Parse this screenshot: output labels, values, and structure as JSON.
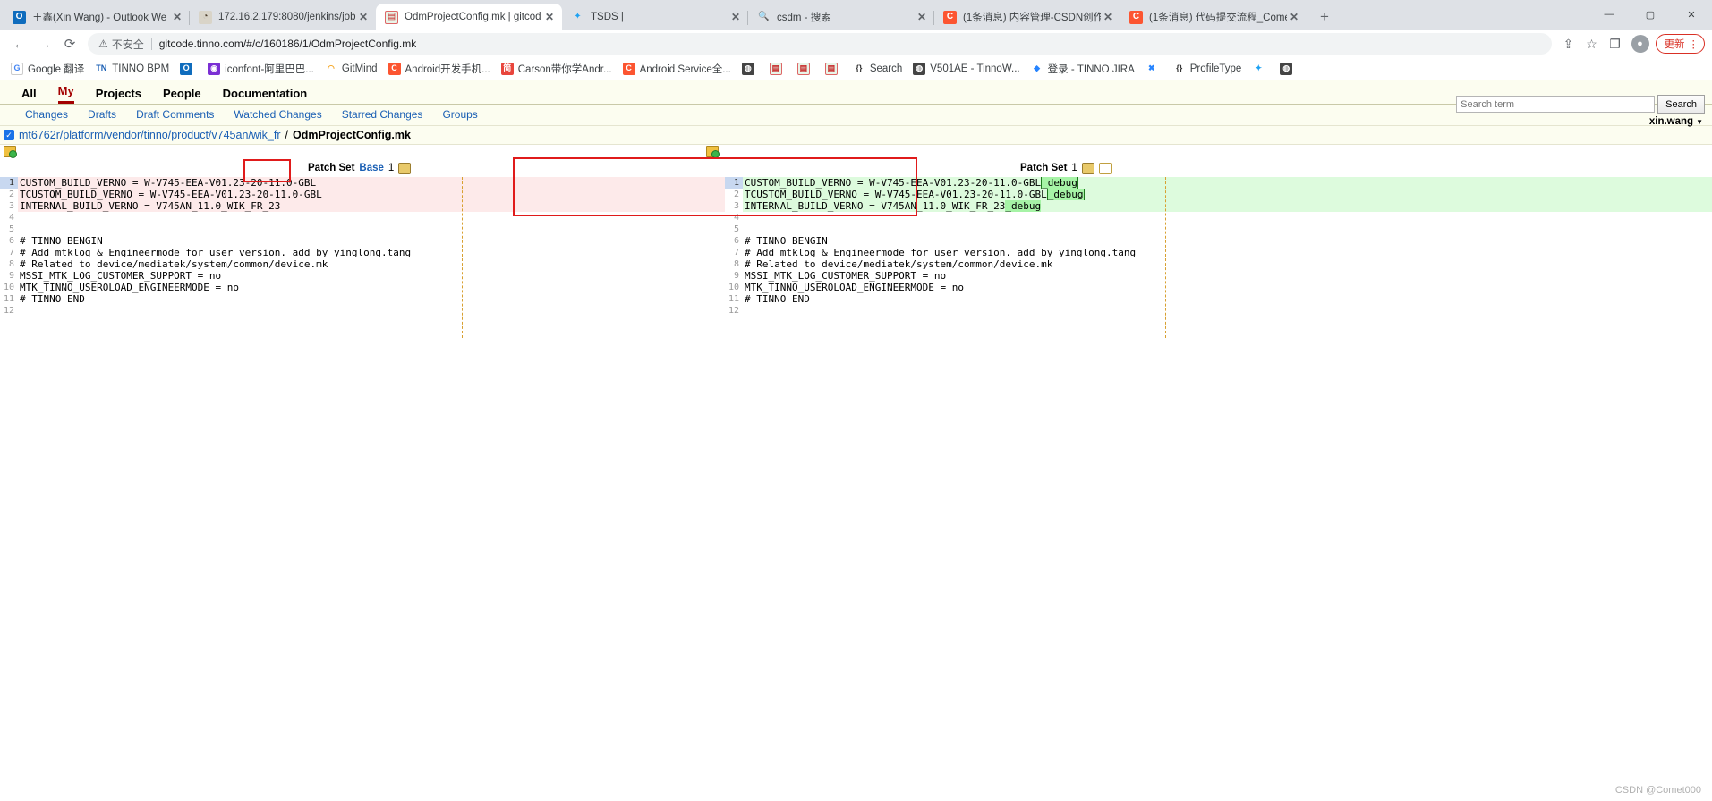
{
  "browser": {
    "tabs": [
      {
        "title": "王鑫(Xin Wang) - Outlook We",
        "favicon": "outlook-icon",
        "active": false
      },
      {
        "title": "172.16.2.179:8080/jenkins/job",
        "favicon": "jenkins-icon",
        "active": false
      },
      {
        "title": "OdmProjectConfig.mk | gitcod",
        "favicon": "gerrit-icon",
        "active": true
      },
      {
        "title": "TSDS |",
        "favicon": "twitter-icon",
        "active": false
      },
      {
        "title": "csdm - 搜索",
        "favicon": "search-icon",
        "active": false
      },
      {
        "title": "(1条消息) 内容管理-CSDN创作",
        "favicon": "csdn-icon",
        "active": false
      },
      {
        "title": "(1条消息) 代码提交流程_Comet",
        "favicon": "csdn-icon",
        "active": false
      }
    ],
    "new_tab_label": "+",
    "window_controls": {
      "minimize": "—",
      "maximize": "▢",
      "close": "✕"
    },
    "nav": {
      "back": "←",
      "forward": "→",
      "reload": "⟳"
    },
    "omnibox": {
      "security_label": "不安全",
      "security_icon": "warning-triangle-icon",
      "url": "gitcode.tinno.com/#/c/160186/1/OdmProjectConfig.mk"
    },
    "toolbar_icons": {
      "share": "share-icon",
      "bookmark": "star-icon",
      "sidepanel": "side-panel-icon",
      "profile": "avatar-icon",
      "update_label": "更新",
      "menu": "kebab-menu-icon"
    },
    "bookmarks": [
      {
        "label": "Google 翻译",
        "icon": "google-translate-icon",
        "icon_class": "bmi-g",
        "glyph": "G"
      },
      {
        "label": "TINNO BPM",
        "icon": "tinno-bpm-icon",
        "icon_class": "bmi-tn",
        "glyph": "TN"
      },
      {
        "label": "",
        "icon": "outlook-icon",
        "icon_class": "bmi-ol",
        "glyph": "O"
      },
      {
        "label": "iconfont-阿里巴巴...",
        "icon": "iconfont-icon",
        "icon_class": "bmi-if",
        "glyph": "◉"
      },
      {
        "label": "GitMind",
        "icon": "gitmind-icon",
        "icon_class": "bmi-gm",
        "glyph": "◠"
      },
      {
        "label": "Android开发手机...",
        "icon": "csdn-icon",
        "icon_class": "bmi-c",
        "glyph": "C"
      },
      {
        "label": "Carson带你学Andr...",
        "icon": "jianshu-icon",
        "icon_class": "bmi-j",
        "glyph": "简"
      },
      {
        "label": "Android Service全...",
        "icon": "csdn-icon",
        "icon_class": "bmi-c",
        "glyph": "C"
      },
      {
        "label": "",
        "icon": "globe-icon",
        "icon_class": "bmi-w",
        "glyph": "◍"
      },
      {
        "label": "",
        "icon": "gerrit-icon",
        "icon_class": "bmi-gr",
        "glyph": "▤"
      },
      {
        "label": "",
        "icon": "gerrit-icon",
        "icon_class": "bmi-gr",
        "glyph": "▤"
      },
      {
        "label": "",
        "icon": "gerrit-icon",
        "icon_class": "bmi-gr",
        "glyph": "▤"
      },
      {
        "label": "Search",
        "icon": "braces-icon",
        "icon_class": "bmi-br",
        "glyph": "{}"
      },
      {
        "label": "V501AE - TinnoW...",
        "icon": "globe-icon",
        "icon_class": "bmi-w",
        "glyph": "◍"
      },
      {
        "label": "登录 - TINNO JIRA",
        "icon": "jira-icon",
        "icon_class": "bmi-ji",
        "glyph": "◆"
      },
      {
        "label": "",
        "icon": "jira-icon",
        "icon_class": "bmi-ji",
        "glyph": "✖"
      },
      {
        "label": "ProfileType",
        "icon": "braces-icon",
        "icon_class": "bmi-br",
        "glyph": "{}"
      },
      {
        "label": "",
        "icon": "twitter-icon",
        "icon_class": "bmi-x",
        "glyph": "✦"
      },
      {
        "label": "",
        "icon": "globe-icon",
        "icon_class": "bmi-w",
        "glyph": "◍"
      }
    ]
  },
  "gerrit": {
    "main_menu": [
      {
        "label": "All",
        "active": false
      },
      {
        "label": "My",
        "active": true
      },
      {
        "label": "Projects",
        "active": false
      },
      {
        "label": "People",
        "active": false
      },
      {
        "label": "Documentation",
        "active": false
      }
    ],
    "sub_menu": [
      "Changes",
      "Drafts",
      "Draft Comments",
      "Watched Changes",
      "Starred Changes",
      "Groups"
    ],
    "search": {
      "placeholder": "Search term",
      "value": "",
      "button_label": "Search"
    },
    "user": "xin.wang",
    "file": {
      "path": "mt6762r/platform/vendor/tinno/product/v745an/wik_fr",
      "separator": "/",
      "name": "OdmProjectConfig.mk"
    },
    "patchset_left": {
      "label": "Patch Set",
      "base": "Base",
      "number": "1"
    },
    "patchset_right": {
      "label": "Patch Set",
      "number": "1"
    }
  },
  "diff": {
    "left": [
      {
        "n": "1",
        "text": "CUSTOM_BUILD_VERNO = W-V745-EEA-V01.23-20-11.0-GBL",
        "type": "del",
        "current": true
      },
      {
        "n": "2",
        "text": "TCUSTOM_BUILD_VERNO = W-V745-EEA-V01.23-20-11.0-GBL",
        "type": "del"
      },
      {
        "n": "3",
        "text": "INTERNAL_BUILD_VERNO = V745AN_11.0_WIK_FR_23",
        "type": "del"
      },
      {
        "n": "4",
        "text": "",
        "type": "del"
      },
      {
        "n": "5",
        "text": "",
        "type": "ctx"
      },
      {
        "n": "6",
        "text": "# TINNO BENGIN",
        "type": "ctx"
      },
      {
        "n": "7",
        "text": "# Add mtklog & Engineermode for user version. add by yinglong.tang",
        "type": "ctx"
      },
      {
        "n": "8",
        "text": "# Related to device/mediatek/system/common/device.mk",
        "type": "ctx"
      },
      {
        "n": "9",
        "text": "MSSI_MTK_LOG_CUSTOMER_SUPPORT = no",
        "type": "ctx"
      },
      {
        "n": "10",
        "text": "MTK_TINNO_USEROLOAD_ENGINEERMODE = no",
        "type": "ctx"
      },
      {
        "n": "11",
        "text": "# TINNO END",
        "type": "ctx"
      },
      {
        "n": "12",
        "text": "",
        "type": "ctx"
      }
    ],
    "right": [
      {
        "n": "1",
        "text": "CUSTOM_BUILD_VERNO = W-V745-EEA-V01.23-20-11.0-GBL",
        "added_token": "_debug",
        "type": "add",
        "current": true,
        "boxed": true
      },
      {
        "n": "2",
        "text": "TCUSTOM_BUILD_VERNO = W-V745-EEA-V01.23-20-11.0-GBL",
        "added_token": "_debug",
        "type": "add",
        "boxed": true
      },
      {
        "n": "3",
        "text": "INTERNAL_BUILD_VERNO = V745AN_11.0_WIK_FR_23",
        "added_token": "_debug",
        "type": "add"
      },
      {
        "n": "4",
        "text": "",
        "type": "add"
      },
      {
        "n": "5",
        "text": "",
        "type": "ctx"
      },
      {
        "n": "6",
        "text": "# TINNO BENGIN",
        "type": "ctx"
      },
      {
        "n": "7",
        "text": "# Add mtklog & Engineermode for user version. add by yinglong.tang",
        "type": "ctx"
      },
      {
        "n": "8",
        "text": "# Related to device/mediatek/system/common/device.mk",
        "type": "ctx"
      },
      {
        "n": "9",
        "text": "MSSI_MTK_LOG_CUSTOMER_SUPPORT = no",
        "type": "ctx"
      },
      {
        "n": "10",
        "text": "MTK_TINNO_USEROLOAD_ENGINEERMODE = no",
        "type": "ctx"
      },
      {
        "n": "11",
        "text": "# TINNO END",
        "type": "ctx"
      },
      {
        "n": "12",
        "text": "",
        "type": "ctx"
      }
    ]
  },
  "watermark": "CSDN @Comet000",
  "colors": {
    "accent_red": "#a30000",
    "link_blue": "#1a5fb4",
    "add_bg": "#ddfbdd",
    "del_bg": "#fdeaea",
    "token_add": "#a6f3a6",
    "annotation_red": "#e01b1b",
    "header_bg": "#fcfdf0"
  }
}
